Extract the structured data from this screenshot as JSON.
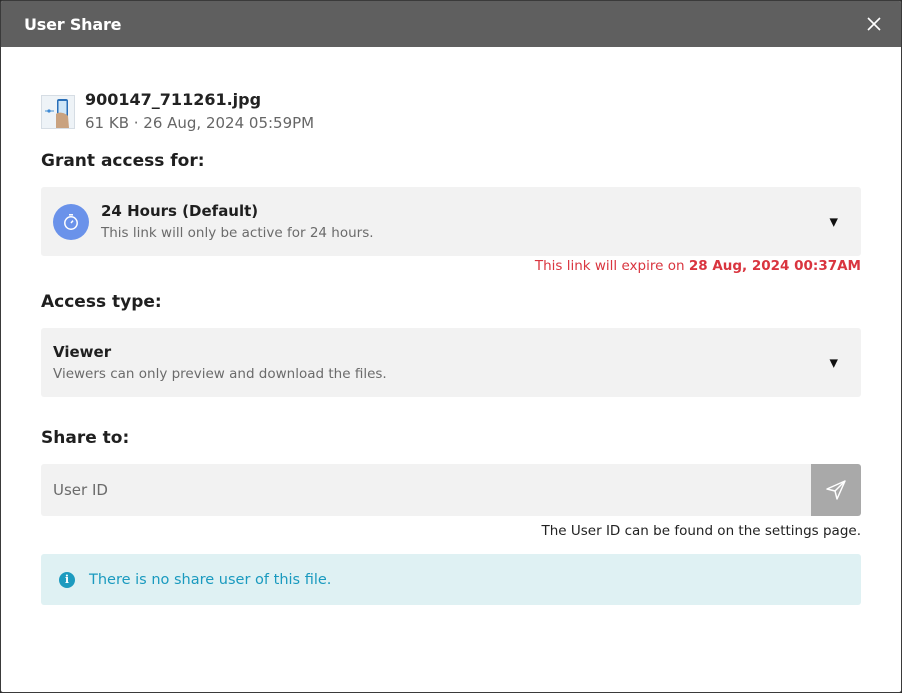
{
  "dialog": {
    "title": "User Share",
    "close_icon": "close-icon"
  },
  "file": {
    "name": "900147_711261.jpg",
    "info": "61 KB · 26 Aug, 2024 05:59PM",
    "thumbnail_icon": "image-thumbnail"
  },
  "grant": {
    "label": "Grant access for:",
    "selected_title": "24 Hours (Default)",
    "selected_desc": "This link will only be active for 24 hours.",
    "icon": "timer-icon",
    "icon_color": "#6a92ea",
    "expire_prefix": "This link will expire on",
    "expire_date": "28 Aug, 2024 00:37AM",
    "expire_color": "#d9353f"
  },
  "access": {
    "label": "Access type:",
    "selected_title": "Viewer",
    "selected_desc": "Viewers can only preview and download the files."
  },
  "share": {
    "label": "Share to:",
    "input_placeholder": "User ID",
    "input_value": "",
    "send_icon": "send-icon",
    "hint": "The User ID can be found on the settings page."
  },
  "info": {
    "icon": "info-icon",
    "text": "There is no share user of this file.",
    "color": "#1a9abf"
  }
}
